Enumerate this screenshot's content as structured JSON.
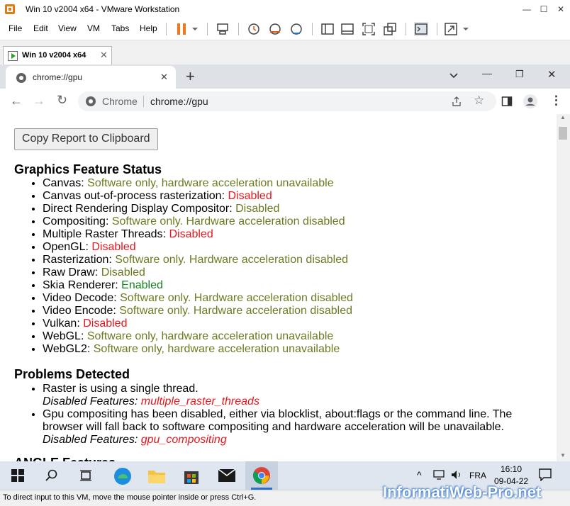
{
  "vmware": {
    "window_title": "Win 10 v2004 x64 - VMware Workstation",
    "menu": [
      "File",
      "Edit",
      "View",
      "VM",
      "Tabs",
      "Help"
    ],
    "vm_tab_label": "Win 10 v2004 x64",
    "status_text": "To direct input to this VM, move the mouse pointer inside or press Ctrl+G."
  },
  "chrome": {
    "tab_title": "chrome://gpu",
    "omnibox_site": "Chrome",
    "omnibox_url": "chrome://gpu"
  },
  "page": {
    "copy_button": "Copy Report to Clipboard",
    "feature_heading": "Graphics Feature Status",
    "features": [
      {
        "name": "Canvas",
        "status": "Software only, hardware acceleration unavailable",
        "color": "#6e7a22"
      },
      {
        "name": "Canvas out-of-process rasterization",
        "status": "Disabled",
        "color": "#e8171d"
      },
      {
        "name": "Direct Rendering Display Compositor",
        "status": "Disabled",
        "color": "#6e7a22"
      },
      {
        "name": "Compositing",
        "status": "Software only. Hardware acceleration disabled",
        "color": "#6e7a22"
      },
      {
        "name": "Multiple Raster Threads",
        "status": "Disabled",
        "color": "#e8171d"
      },
      {
        "name": "OpenGL",
        "status": "Disabled",
        "color": "#e8171d"
      },
      {
        "name": "Rasterization",
        "status": "Software only. Hardware acceleration disabled",
        "color": "#6e7a22"
      },
      {
        "name": "Raw Draw",
        "status": "Disabled",
        "color": "#6e7a22"
      },
      {
        "name": "Skia Renderer",
        "status": "Enabled",
        "color": "#15811e"
      },
      {
        "name": "Video Decode",
        "status": "Software only. Hardware acceleration disabled",
        "color": "#6e7a22"
      },
      {
        "name": "Video Encode",
        "status": "Software only. Hardware acceleration disabled",
        "color": "#6e7a22"
      },
      {
        "name": "Vulkan",
        "status": "Disabled",
        "color": "#e8171d"
      },
      {
        "name": "WebGL",
        "status": "Software only, hardware acceleration unavailable",
        "color": "#6e7a22"
      },
      {
        "name": "WebGL2",
        "status": "Software only, hardware acceleration unavailable",
        "color": "#6e7a22"
      }
    ],
    "problems_heading": "Problems Detected",
    "problems": [
      {
        "text": "Raster is using a single thread.",
        "disabled_label": "Disabled Features:",
        "feature": "multiple_raster_threads"
      },
      {
        "text": "Gpu compositing has been disabled, either via blocklist, about:flags or the command line. The browser will fall back to software compositing and hardware acceleration will be unavailable.",
        "disabled_label": "Disabled Features:",
        "feature": "gpu_compositing"
      }
    ],
    "next_heading_partial": "ANGLE Features"
  },
  "taskbar": {
    "lang": "FRA",
    "time": "16:10",
    "date": "09-04-22"
  },
  "watermark": "InformatiWeb-Pro.net"
}
